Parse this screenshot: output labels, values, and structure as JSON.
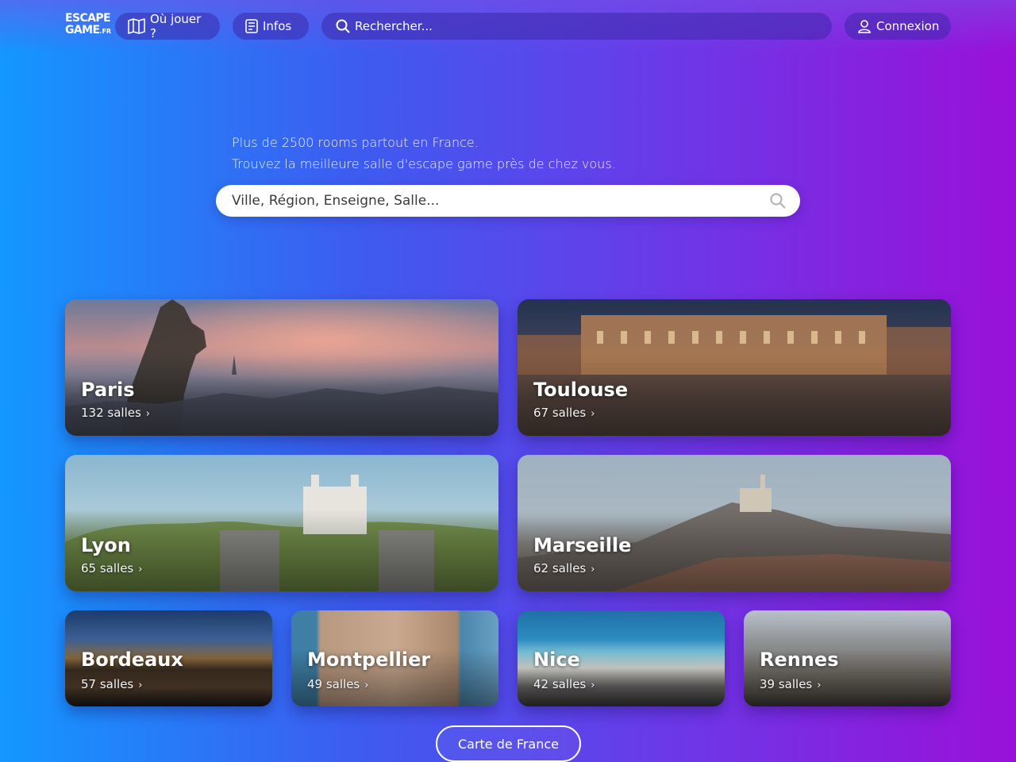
{
  "header": {
    "logo_top": "ESCAPE",
    "logo_bottom": "GAME",
    "logo_suffix": ".FR",
    "nav": {
      "where_label": "Où jouer ?",
      "infos_label": "Infos",
      "search_placeholder": "Rechercher...",
      "login_label": "Connexion"
    }
  },
  "hero": {
    "line1": "Plus de 2500 rooms partout en France.",
    "line2": "Trouvez la meilleure salle d'escape game près de chez vous.",
    "search_placeholder": "Ville, Région, Enseigne, Salle..."
  },
  "cities": [
    {
      "name": "Paris",
      "count": "132 salles",
      "chevron": "›"
    },
    {
      "name": "Toulouse",
      "count": "67 salles",
      "chevron": "›"
    },
    {
      "name": "Lyon",
      "count": "65 salles",
      "chevron": "›"
    },
    {
      "name": "Marseille",
      "count": "62 salles",
      "chevron": "›"
    },
    {
      "name": "Bordeaux",
      "count": "57 salles",
      "chevron": "›"
    },
    {
      "name": "Montpellier",
      "count": "49 salles",
      "chevron": "›"
    },
    {
      "name": "Nice",
      "count": "42 salles",
      "chevron": "›"
    },
    {
      "name": "Rennes",
      "count": "39 salles",
      "chevron": "›"
    }
  ],
  "map_button_label": "Carte de France",
  "colors": {
    "gradient_left": "#1497ff",
    "gradient_right": "#9a10d9",
    "pill_bg": "#3c28aa"
  },
  "icons": [
    "map-icon",
    "document-icon",
    "search-icon",
    "user-icon",
    "magnifier-icon"
  ]
}
